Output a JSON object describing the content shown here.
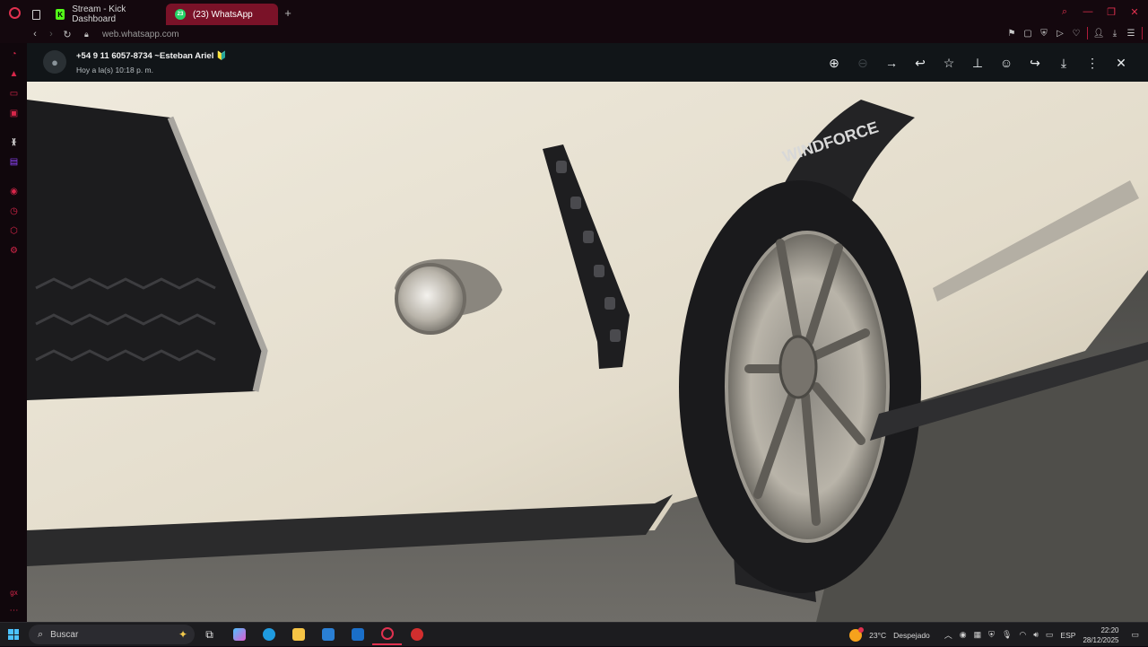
{
  "browser": {
    "tabs": [
      {
        "label": "",
        "kind": "blank"
      },
      {
        "label": "Stream - Kick Dashboard",
        "kind": "kick",
        "icon_text": "K"
      },
      {
        "label": "(23) WhatsApp",
        "kind": "whatsapp",
        "icon_text": "23",
        "active": true
      }
    ],
    "new_tab_symbol": "+",
    "url_domain": "web.whatsapp.com",
    "accent_color": "#e0314f"
  },
  "viewer": {
    "sender_name": "+54 9 11 6057-8734 ~Esteban Ariel 🔰",
    "timestamp": "Hoy a la(s) 10:18 p. m.",
    "actions": [
      "zoom-in",
      "zoom-out",
      "go-to-message",
      "reply",
      "star",
      "pin",
      "react",
      "forward",
      "download",
      "more-options",
      "close"
    ]
  },
  "photo": {
    "tire_brand_text": "WINDFORCE",
    "tire_color": "#1a1a1c",
    "body_color": "#e8e2d3"
  },
  "taskbar": {
    "search_placeholder": "Buscar",
    "weather_temp": "23°C",
    "weather_text": "Despejado",
    "language": "ESP",
    "time": "22:20",
    "date": "28/12/2025"
  }
}
